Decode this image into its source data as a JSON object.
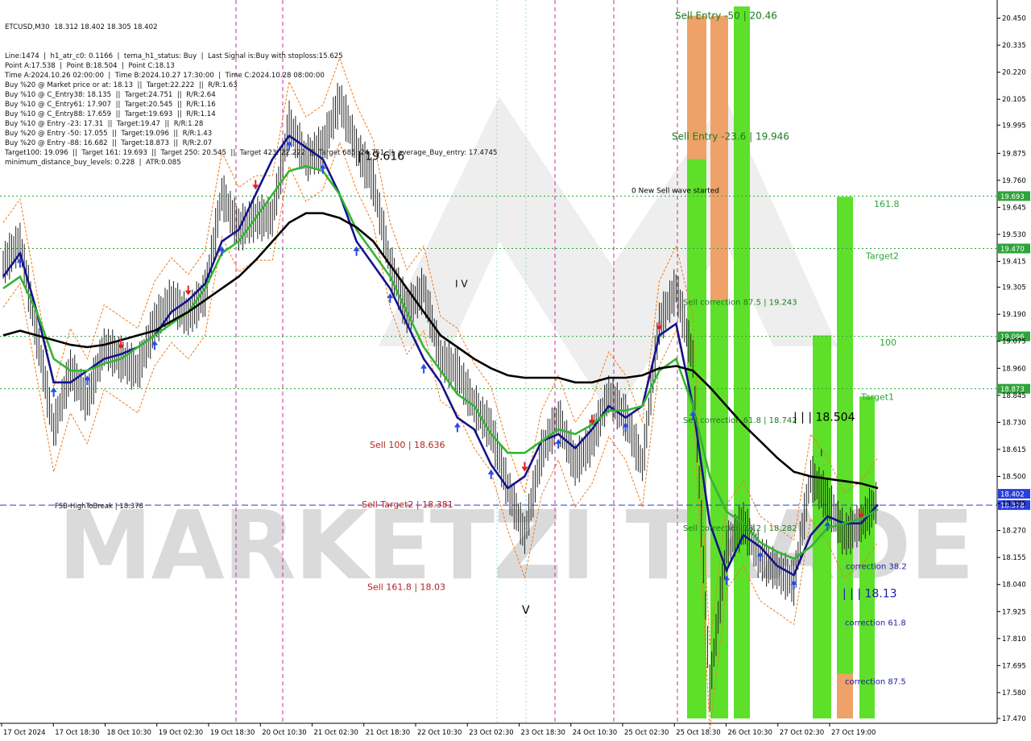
{
  "header": {
    "symbol_line": "ETCUSD,M30  18.312 18.402 18.305 18.402",
    "info_lines": [
      "Line:1474  |  h1_atr_c0: 0.1166  |  tema_h1_status: Buy  |  Last Signal is:Buy with stoploss:15.625",
      "Point A:17.538  |  Point B:18.504  |  Point C:18.13",
      "Time A:2024.10.26 02:00:00  |  Time B:2024.10.27 17:30:00  |  Time C:2024.10.28 08:00:00",
      "Buy %20 @ Market price or at: 18.13  ||  Target:22.222  ||  R/R:1.63",
      "Buy %10 @ C_Entry38: 18.135  ||  Target:24.751  ||  R/R:2.64",
      "Buy %10 @ C_Entry61: 17.907  ||  Target:20.545  ||  R/R:1.16",
      "Buy %10 @ C_Entry88: 17.659  ||  Target:19.693  ||  R/R:1.14",
      "Buy %10 @ Entry -23: 17.31  ||  Target:19.47  ||  R/R:1.28",
      "Buy %20 @ Entry -50: 17.055  ||  Target:19.096  ||  R/R:1.43",
      "Buy %20 @ Entry -88: 16.682  ||  Target:18.873  ||  R/R:2.07",
      "Target100: 19.096  ||  Target 161: 19.693  ||  Target 250: 20.545  ||  Target 423: 22.222  ||  Target 685: 24.751  ||  average_Buy_entry: 17.4745",
      "minimum_distance_buy_levels: 0.228  |  ATR:0.085"
    ]
  },
  "chart_data": {
    "type": "line",
    "symbol": "ETCUSD",
    "timeframe": "M30",
    "ylim": [
      17.47,
      20.5
    ],
    "price_ticks": [
      "20.450",
      "20.335",
      "20.220",
      "20.105",
      "19.995",
      "19.875",
      "19.760",
      "19.645",
      "19.530",
      "19.415",
      "19.305",
      "19.190",
      "19.075",
      "18.960",
      "18.845",
      "18.730",
      "18.615",
      "18.500",
      "18.385",
      "18.270",
      "18.155",
      "18.040",
      "17.925",
      "17.810",
      "17.695",
      "17.580",
      "17.470"
    ],
    "x_labels": [
      "17 Oct 2024",
      "17 Oct 18:30",
      "18 Oct 10:30",
      "19 Oct 02:30",
      "19 Oct 18:30",
      "20 Oct 10:30",
      "21 Oct 02:30",
      "21 Oct 18:30",
      "22 Oct 10:30",
      "23 Oct 02:30",
      "23 Oct 18:30",
      "24 Oct 10:30",
      "25 Oct 02:30",
      "25 Oct 18:30",
      "26 Oct 10:30",
      "27 Oct 02:30",
      "27 Oct 19:00"
    ],
    "horizontal_levels": [
      {
        "price": 19.693,
        "label": "19.693",
        "color": "#2ea43a",
        "style": "dotted"
      },
      {
        "price": 19.47,
        "label": "19.470",
        "color": "#2ea43a",
        "style": "dotted"
      },
      {
        "price": 19.096,
        "label": "19.096",
        "color": "#2ea43a",
        "style": "dotted"
      },
      {
        "price": 18.873,
        "label": "18.873",
        "color": "#2ea43a",
        "style": "dotted"
      },
      {
        "price": 18.378,
        "label": "18.378",
        "color": "#2b3fd6",
        "style": "dashed"
      }
    ],
    "last_price": {
      "price": 18.402,
      "label": "18.402"
    },
    "annotations": [
      {
        "text": "Sell Entry -50 | 20.46",
        "price": 20.46,
        "color": "#1e7a1e"
      },
      {
        "text": "Sell Entry -23.6 | 19.946",
        "price": 19.946,
        "color": "#1e7a1e"
      },
      {
        "text": "0 New Sell wave started",
        "price": 19.72,
        "color": "#000000"
      },
      {
        "text": "Sell correction 87.5 | 19.243",
        "price": 19.243,
        "color": "#1e7a1e"
      },
      {
        "text": "Sell correction 61.8 | 18.742",
        "price": 18.742,
        "color": "#1e7a1e"
      },
      {
        "text": "Sell correction 38.2 | 18.282",
        "price": 18.282,
        "color": "#1e7a1e"
      },
      {
        "text": "Sell 100 | 18.636",
        "price": 18.636,
        "color": "#b22222"
      },
      {
        "text": "Sell Target2 | 18.381",
        "price": 18.381,
        "color": "#b22222"
      },
      {
        "text": "Sell 161.8 | 18.03",
        "price": 18.03,
        "color": "#b22222"
      },
      {
        "text": "FSB-HighToBreak | 18.378",
        "price": 18.378,
        "color": "#111111"
      },
      {
        "text": "| 19.616",
        "price": 19.86,
        "color": "#000000"
      },
      {
        "text": "| | | 18.504",
        "price": 18.75,
        "color": "#000000"
      },
      {
        "text": "| | | 18.13",
        "price": 18.0,
        "color": "#1a1aa6"
      },
      {
        "text": "161.8",
        "price": 19.66,
        "color": "#2ea43a"
      },
      {
        "text": "Target2",
        "price": 19.44,
        "color": "#2ea43a"
      },
      {
        "text": "100",
        "price": 19.07,
        "color": "#2ea43a"
      },
      {
        "text": "Target1",
        "price": 18.84,
        "color": "#2ea43a"
      },
      {
        "text": "correction 38.2",
        "price": 18.12,
        "color": "#1a1aa6"
      },
      {
        "text": "correction 61.8",
        "price": 17.88,
        "color": "#1a1aa6"
      },
      {
        "text": "correction 87.5",
        "price": 17.63,
        "color": "#1a1aa6"
      },
      {
        "text": "I V",
        "price": 19.32,
        "color": "#000000"
      },
      {
        "text": "V",
        "price": 17.93,
        "color": "#000000"
      },
      {
        "text": "I",
        "price": 18.6,
        "color": "#1a1aa6"
      }
    ],
    "watermark": "MARKETZI TRADE",
    "series": [
      {
        "name": "price",
        "color": "#000000",
        "values": [
          19.4,
          19.5,
          19.1,
          18.7,
          18.95,
          18.82,
          19.05,
          19.0,
          18.95,
          19.15,
          19.25,
          19.18,
          19.28,
          19.7,
          19.55,
          19.6,
          19.6,
          20.0,
          19.85,
          19.9,
          20.1,
          19.9,
          19.75,
          19.4,
          19.2,
          19.3,
          19.0,
          18.95,
          18.8,
          18.7,
          18.45,
          18.25,
          18.6,
          18.75,
          18.55,
          18.65,
          18.85,
          18.75,
          18.55,
          19.15,
          19.3,
          19.0,
          17.6,
          18.2,
          18.3,
          18.15,
          18.1,
          18.05,
          18.5,
          18.4,
          18.25,
          18.3,
          18.4
        ]
      },
      {
        "name": "fast ma",
        "color": "#14148a",
        "values": [
          19.35,
          19.45,
          19.2,
          18.9,
          18.9,
          18.95,
          19.0,
          19.02,
          19.05,
          19.1,
          19.2,
          19.25,
          19.32,
          19.5,
          19.55,
          19.7,
          19.85,
          19.95,
          19.9,
          19.85,
          19.7,
          19.5,
          19.4,
          19.3,
          19.15,
          19.0,
          18.9,
          18.75,
          18.7,
          18.55,
          18.45,
          18.5,
          18.65,
          18.68,
          18.62,
          18.7,
          18.8,
          18.75,
          18.8,
          19.1,
          19.15,
          18.8,
          18.3,
          18.1,
          18.25,
          18.2,
          18.12,
          18.08,
          18.25,
          18.33,
          18.3,
          18.3,
          18.38
        ]
      },
      {
        "name": "mid ma",
        "color": "#34b534",
        "values": [
          19.3,
          19.35,
          19.2,
          19.0,
          18.95,
          18.95,
          18.98,
          19.0,
          19.05,
          19.1,
          19.15,
          19.2,
          19.3,
          19.45,
          19.5,
          19.6,
          19.7,
          19.8,
          19.82,
          19.8,
          19.7,
          19.55,
          19.45,
          19.35,
          19.2,
          19.05,
          18.95,
          18.85,
          18.8,
          18.68,
          18.6,
          18.6,
          18.65,
          18.7,
          18.68,
          18.72,
          18.78,
          18.78,
          18.8,
          18.95,
          19.0,
          18.8,
          18.5,
          18.35,
          18.3,
          18.22,
          18.18,
          18.15,
          18.2,
          18.28,
          18.3,
          18.32,
          18.36
        ]
      },
      {
        "name": "slow ma",
        "color": "#000000",
        "values": [
          19.1,
          19.12,
          19.1,
          19.08,
          19.06,
          19.05,
          19.06,
          19.08,
          19.1,
          19.12,
          19.16,
          19.2,
          19.25,
          19.3,
          19.35,
          19.42,
          19.5,
          19.58,
          19.62,
          19.62,
          19.6,
          19.56,
          19.5,
          19.4,
          19.3,
          19.2,
          19.1,
          19.05,
          19.0,
          18.96,
          18.93,
          18.92,
          18.92,
          18.92,
          18.9,
          18.9,
          18.92,
          18.92,
          18.93,
          18.96,
          18.97,
          18.95,
          18.88,
          18.8,
          18.72,
          18.65,
          18.58,
          18.52,
          18.5,
          18.49,
          18.48,
          18.47,
          18.45
        ]
      }
    ]
  }
}
